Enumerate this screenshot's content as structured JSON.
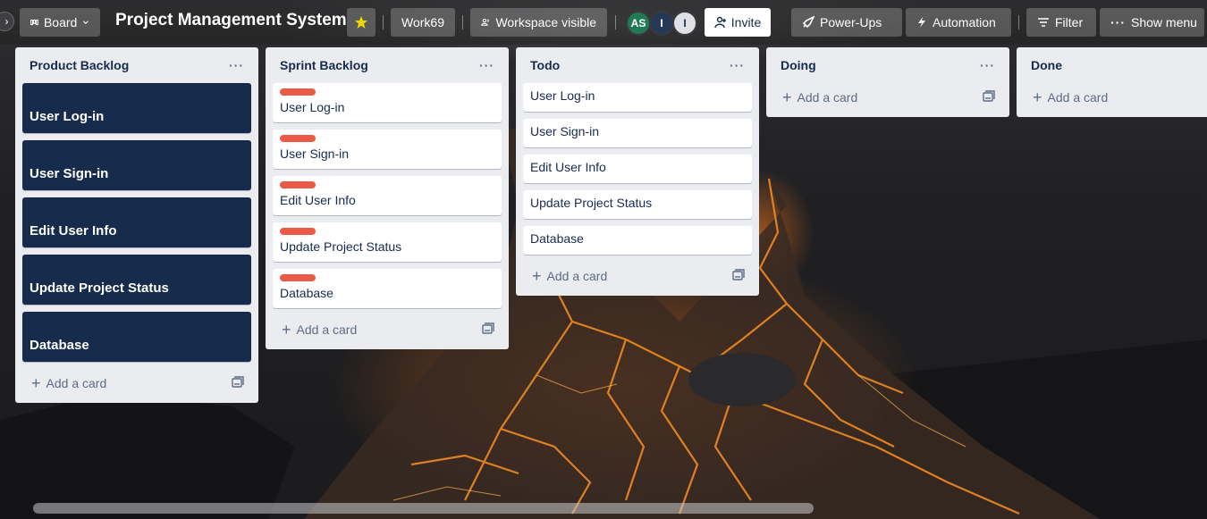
{
  "header": {
    "view_label": "Board",
    "board_title": "Project Management System",
    "workspace": "Work69",
    "visibility": "Workspace visible",
    "members": [
      {
        "initials": "AS",
        "color": "#1f7a55",
        "text_color": "#ffffff"
      },
      {
        "initials": "I",
        "color": "#253858",
        "text_color": "#ffffff"
      },
      {
        "initials": "I",
        "color": "#dfe1e6",
        "text_color": "#172b4d"
      }
    ],
    "invite_label": "Invite",
    "power_ups_label": "Power-Ups",
    "automation_label": "Automation",
    "filter_label": "Filter",
    "show_menu_label": "Show menu",
    "star_color": "#f2d600"
  },
  "lists": [
    {
      "title": "Product Backlog",
      "style": "dark",
      "cards": [
        "User Log-in",
        "User Sign-in",
        "Edit User Info",
        "Update Project Status",
        "Database"
      ],
      "add_label": "Add a card"
    },
    {
      "title": "Sprint Backlog",
      "style": "labeled",
      "label_color": "#eb5a46",
      "cards": [
        "User Log-in",
        "User Sign-in",
        "Edit User Info",
        "Update Project Status",
        "Database"
      ],
      "add_label": "Add a card"
    },
    {
      "title": "Todo",
      "style": "plain",
      "cards": [
        "User Log-in",
        "User Sign-in",
        "Edit User Info",
        "Update Project Status",
        "Database"
      ],
      "add_label": "Add a card"
    },
    {
      "title": "Doing",
      "style": "plain",
      "cards": [],
      "add_label": "Add a card"
    },
    {
      "title": "Done",
      "style": "plain",
      "cards": [],
      "add_label": "Add a card"
    }
  ]
}
